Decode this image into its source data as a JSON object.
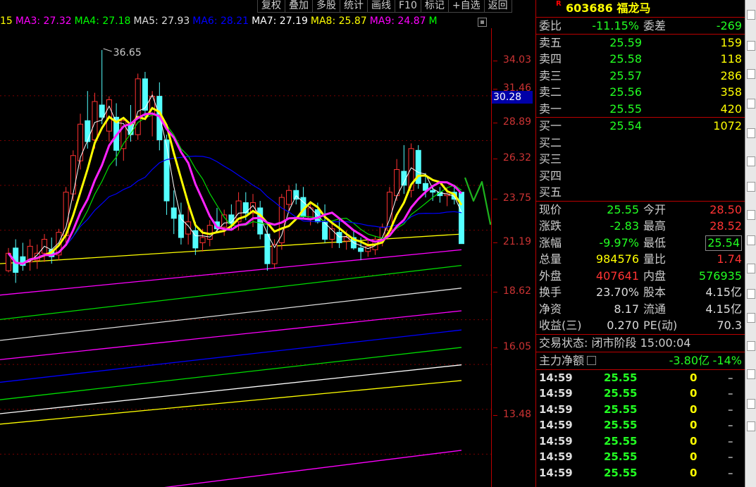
{
  "toolbar": {
    "buttons": [
      "复权",
      "叠加",
      "多股",
      "统计",
      "画线",
      "F10",
      "标记",
      "+自选",
      "返回"
    ]
  },
  "ma_legend": [
    {
      "label": "15",
      "color": "#ff0"
    },
    {
      "label": "MA3: 27.32",
      "color": "#ff00ff"
    },
    {
      "label": "MA4: 27.18",
      "color": "#00ff00"
    },
    {
      "label": "MA5: 27.93",
      "color": "#dddddd"
    },
    {
      "label": "MA6: 28.21",
      "color": "#0000ff"
    },
    {
      "label": "MA7: 27.19",
      "color": "#ffffff"
    },
    {
      "label": "MA8: 25.87",
      "color": "#ffff00"
    },
    {
      "label": "MA9: 24.87",
      "color": "#ff00ff"
    },
    {
      "label": "M",
      "color": "#00ff00"
    }
  ],
  "chart": {
    "high_label": "36.65",
    "price_ticks": [
      "34.03",
      "31.46",
      "28.89",
      "26.32",
      "23.75",
      "21.19",
      "18.62",
      "16.05",
      "13.48"
    ],
    "cursor_price": "30.28"
  },
  "stock": {
    "badge": "R",
    "code": "603686",
    "name": "福龙马"
  },
  "ratio": {
    "label1": "委比",
    "value1": "-11.15%",
    "label2": "委差",
    "value2": "-269"
  },
  "asks": [
    {
      "label": "卖五",
      "price": "25.59",
      "vol": "159"
    },
    {
      "label": "卖四",
      "price": "25.58",
      "vol": "118"
    },
    {
      "label": "卖三",
      "price": "25.57",
      "vol": "286"
    },
    {
      "label": "卖二",
      "price": "25.56",
      "vol": "358"
    },
    {
      "label": "卖一",
      "price": "25.55",
      "vol": "420"
    }
  ],
  "bids": [
    {
      "label": "买一",
      "price": "25.54",
      "vol": "1072"
    },
    {
      "label": "买二",
      "price": "",
      "vol": ""
    },
    {
      "label": "买三",
      "price": "",
      "vol": ""
    },
    {
      "label": "买四",
      "price": "",
      "vol": ""
    },
    {
      "label": "买五",
      "price": "",
      "vol": ""
    }
  ],
  "quote": [
    {
      "l1": "现价",
      "v1": "25.55",
      "c1": "green",
      "l2": "今开",
      "v2": "28.50",
      "c2": "red"
    },
    {
      "l1": "涨跌",
      "v1": "-2.83",
      "c1": "green",
      "l2": "最高",
      "v2": "28.52",
      "c2": "red"
    },
    {
      "l1": "涨幅",
      "v1": "-9.97%",
      "c1": "green",
      "l2": "最低",
      "v2": "25.54",
      "c2": "green"
    },
    {
      "l1": "总量",
      "v1": "984576",
      "c1": "yellow",
      "l2": "量比",
      "v2": "1.74",
      "c2": "red"
    },
    {
      "l1": "外盘",
      "v1": "407641",
      "c1": "red",
      "l2": "内盘",
      "v2": "576935",
      "c2": "green"
    },
    {
      "l1": "换手",
      "v1": "23.70%",
      "c1": "white",
      "l2": "股本",
      "v2": "4.15亿",
      "c2": "white"
    },
    {
      "l1": "净资",
      "v1": "8.17",
      "c1": "white",
      "l2": "流通",
      "v2": "4.15亿",
      "c2": "white"
    },
    {
      "l1": "收益(三)",
      "v1": "0.270",
      "c1": "white",
      "l2": "PE(动)",
      "v2": "70.3",
      "c2": "white"
    }
  ],
  "status": {
    "label": "交易状态:",
    "value": "闭市阶段 15:00:04"
  },
  "fund_flow": {
    "label": "主力净额",
    "value": "-3.80亿",
    "pct": "-14%"
  },
  "ticks": [
    {
      "time": "14:59",
      "price": "25.55",
      "vol": "0",
      "dir": "–"
    },
    {
      "time": "14:59",
      "price": "25.55",
      "vol": "0",
      "dir": "–"
    },
    {
      "time": "14:59",
      "price": "25.55",
      "vol": "0",
      "dir": "–"
    },
    {
      "time": "14:59",
      "price": "25.55",
      "vol": "0",
      "dir": "–"
    },
    {
      "time": "14:59",
      "price": "25.55",
      "vol": "0",
      "dir": "–"
    },
    {
      "time": "14:59",
      "price": "25.55",
      "vol": "0",
      "dir": "–"
    },
    {
      "time": "14:59",
      "price": "25.55",
      "vol": "0",
      "dir": "–"
    }
  ],
  "chart_data": {
    "type": "candlestick",
    "title": "",
    "ylim": [
      12.0,
      37.5
    ],
    "candles": [
      {
        "o": 24.0,
        "h": 25.3,
        "l": 23.9,
        "c": 25.0
      },
      {
        "o": 25.3,
        "h": 25.8,
        "l": 23.3,
        "c": 23.9
      },
      {
        "o": 24.8,
        "h": 25.6,
        "l": 24.0,
        "c": 24.3
      },
      {
        "o": 24.5,
        "h": 25.8,
        "l": 24.0,
        "c": 25.4
      },
      {
        "o": 24.6,
        "h": 25.5,
        "l": 24.1,
        "c": 25.0
      },
      {
        "o": 25.0,
        "h": 26.1,
        "l": 24.5,
        "c": 25.8
      },
      {
        "o": 25.2,
        "h": 25.9,
        "l": 24.4,
        "c": 24.8
      },
      {
        "o": 24.9,
        "h": 26.4,
        "l": 24.6,
        "c": 26.2
      },
      {
        "o": 26.0,
        "h": 28.8,
        "l": 25.6,
        "c": 28.5
      },
      {
        "o": 28.4,
        "h": 30.9,
        "l": 28.0,
        "c": 30.6
      },
      {
        "o": 30.3,
        "h": 33.0,
        "l": 29.8,
        "c": 32.4
      },
      {
        "o": 32.6,
        "h": 34.3,
        "l": 31.0,
        "c": 31.4
      },
      {
        "o": 31.5,
        "h": 34.2,
        "l": 31.0,
        "c": 33.7
      },
      {
        "o": 33.5,
        "h": 36.65,
        "l": 32.4,
        "c": 32.8
      },
      {
        "o": 32.0,
        "h": 34.0,
        "l": 31.4,
        "c": 33.8
      },
      {
        "o": 32.8,
        "h": 33.6,
        "l": 30.0,
        "c": 30.9
      },
      {
        "o": 31.0,
        "h": 32.8,
        "l": 30.3,
        "c": 32.6
      },
      {
        "o": 32.4,
        "h": 33.5,
        "l": 31.4,
        "c": 31.8
      },
      {
        "o": 31.8,
        "h": 35.3,
        "l": 31.5,
        "c": 35.0
      },
      {
        "o": 35.0,
        "h": 35.4,
        "l": 32.7,
        "c": 33.2
      },
      {
        "o": 33.0,
        "h": 34.3,
        "l": 31.7,
        "c": 34.0
      },
      {
        "o": 34.0,
        "h": 34.8,
        "l": 30.9,
        "c": 31.5
      },
      {
        "o": 31.5,
        "h": 31.8,
        "l": 27.2,
        "c": 28.0
      },
      {
        "o": 27.6,
        "h": 28.6,
        "l": 26.1,
        "c": 27.0
      },
      {
        "o": 27.2,
        "h": 27.9,
        "l": 25.5,
        "c": 25.9
      },
      {
        "o": 26.1,
        "h": 27.7,
        "l": 25.5,
        "c": 26.8
      },
      {
        "o": 26.3,
        "h": 26.8,
        "l": 24.9,
        "c": 25.3
      },
      {
        "o": 25.6,
        "h": 26.4,
        "l": 25.1,
        "c": 25.9
      },
      {
        "o": 25.8,
        "h": 26.9,
        "l": 25.4,
        "c": 26.6
      },
      {
        "o": 26.8,
        "h": 27.6,
        "l": 26.2,
        "c": 26.4
      },
      {
        "o": 26.5,
        "h": 27.5,
        "l": 26.0,
        "c": 27.2
      },
      {
        "o": 27.2,
        "h": 27.8,
        "l": 26.3,
        "c": 26.7
      },
      {
        "o": 26.8,
        "h": 28.5,
        "l": 26.3,
        "c": 28.0
      },
      {
        "o": 27.9,
        "h": 28.5,
        "l": 26.9,
        "c": 27.3
      },
      {
        "o": 27.3,
        "h": 28.4,
        "l": 26.5,
        "c": 27.9
      },
      {
        "o": 27.6,
        "h": 28.0,
        "l": 25.8,
        "c": 26.1
      },
      {
        "o": 26.1,
        "h": 26.6,
        "l": 24.0,
        "c": 24.4
      },
      {
        "o": 24.4,
        "h": 25.8,
        "l": 24.1,
        "c": 25.5
      },
      {
        "o": 25.6,
        "h": 28.4,
        "l": 25.2,
        "c": 28.2
      },
      {
        "o": 27.8,
        "h": 28.9,
        "l": 27.4,
        "c": 28.6
      },
      {
        "o": 28.6,
        "h": 29.0,
        "l": 27.8,
        "c": 28.1
      },
      {
        "o": 28.2,
        "h": 28.8,
        "l": 27.0,
        "c": 27.1
      },
      {
        "o": 27.0,
        "h": 27.9,
        "l": 26.6,
        "c": 27.6
      },
      {
        "o": 27.5,
        "h": 27.9,
        "l": 26.7,
        "c": 26.8
      },
      {
        "o": 26.8,
        "h": 27.8,
        "l": 25.6,
        "c": 25.8
      },
      {
        "o": 25.8,
        "h": 26.8,
        "l": 25.3,
        "c": 26.4
      },
      {
        "o": 26.2,
        "h": 26.9,
        "l": 25.3,
        "c": 25.6
      },
      {
        "o": 25.7,
        "h": 26.3,
        "l": 25.2,
        "c": 25.9
      },
      {
        "o": 25.9,
        "h": 26.3,
        "l": 25.2,
        "c": 25.3
      },
      {
        "o": 25.3,
        "h": 25.9,
        "l": 24.6,
        "c": 25.1
      },
      {
        "o": 25.1,
        "h": 25.7,
        "l": 24.8,
        "c": 25.4
      },
      {
        "o": 25.2,
        "h": 26.0,
        "l": 24.9,
        "c": 25.8
      },
      {
        "o": 25.8,
        "h": 26.7,
        "l": 25.4,
        "c": 26.5
      },
      {
        "o": 26.3,
        "h": 28.8,
        "l": 26.1,
        "c": 28.5
      },
      {
        "o": 28.3,
        "h": 30.4,
        "l": 28.0,
        "c": 29.8
      },
      {
        "o": 29.7,
        "h": 31.2,
        "l": 28.4,
        "c": 28.9
      },
      {
        "o": 28.6,
        "h": 31.3,
        "l": 28.2,
        "c": 31.0
      },
      {
        "o": 30.9,
        "h": 31.2,
        "l": 28.7,
        "c": 29.0
      },
      {
        "o": 29.0,
        "h": 29.6,
        "l": 28.2,
        "c": 28.6
      },
      {
        "o": 28.6,
        "h": 28.9,
        "l": 28.0,
        "c": 28.5
      },
      {
        "o": 28.5,
        "h": 28.8,
        "l": 27.9,
        "c": 28.3
      },
      {
        "o": 28.3,
        "h": 28.8,
        "l": 27.7,
        "c": 28.4
      },
      {
        "o": 28.5,
        "h": 28.9,
        "l": 27.8,
        "c": 28.1
      },
      {
        "o": 28.5,
        "h": 28.52,
        "l": 25.54,
        "c": 25.55
      }
    ]
  }
}
